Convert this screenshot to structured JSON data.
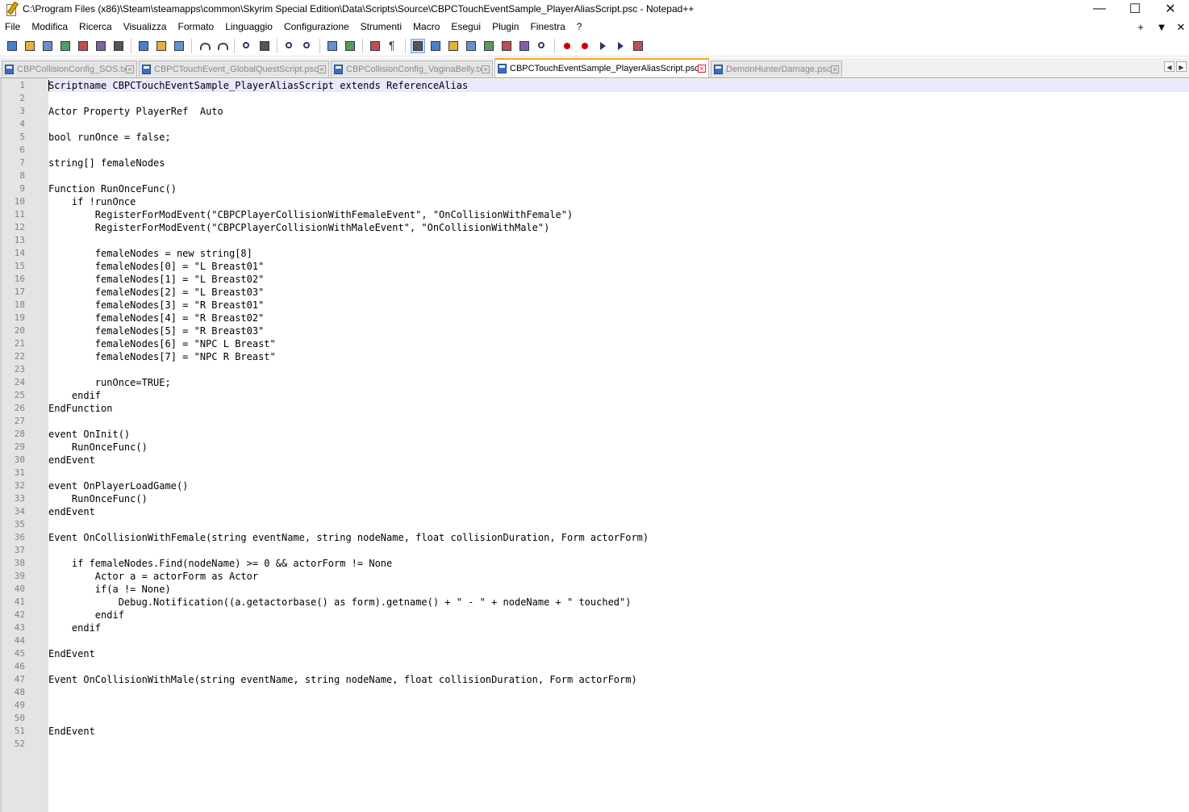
{
  "window": {
    "title": "C:\\Program Files (x86)\\Steam\\steamapps\\common\\Skyrim Special Edition\\Data\\Scripts\\Source\\CBPCTouchEventSample_PlayerAliasScript.psc - Notepad++",
    "minimize_glyph": "—",
    "maximize_glyph": "☐",
    "close_glyph": "✕"
  },
  "menu": {
    "items": [
      "File",
      "Modifica",
      "Ricerca",
      "Visualizza",
      "Formato",
      "Linguaggio",
      "Configurazione",
      "Strumenti",
      "Macro",
      "Esegui",
      "Plugin",
      "Finestra",
      "?"
    ],
    "right": [
      "+",
      "▼",
      "✕"
    ]
  },
  "toolbar": {
    "icons": [
      "new-file-icon",
      "open-file-icon",
      "save-icon",
      "save-all-icon",
      "close-icon",
      "close-all-icon",
      "print-icon",
      "|",
      "cut-icon",
      "copy-icon",
      "paste-icon",
      "|",
      "undo-icon",
      "redo-icon",
      "|",
      "find-icon",
      "replace-icon",
      "|",
      "zoom-in-icon",
      "zoom-out-icon",
      "|",
      "sync-vertical-icon",
      "sync-horizontal-icon",
      "|",
      "word-wrap-icon",
      "show-all-chars-icon",
      "|",
      "indent-guide-icon",
      "user-language-icon",
      "doc-map-icon",
      "function-list-icon",
      "folder-workspace-icon",
      "monitoring-icon",
      "doc-list-icon",
      "eye-icon",
      "|",
      "record-macro-icon",
      "stop-record-icon",
      "play-macro-icon",
      "run-macro-multiple-icon",
      "save-macro-icon"
    ],
    "active_icon": "indent-guide-icon"
  },
  "tabs": [
    {
      "label": "CBPCollisionConfig_SOS.txt",
      "active": false
    },
    {
      "label": "CBPCTouchEvent_GlobalQuestScript.psc",
      "active": false
    },
    {
      "label": "CBPCollisionConfig_VaginaBelly.txt",
      "active": false
    },
    {
      "label": "CBPCTouchEventSample_PlayerAliasScript.psc",
      "active": true
    },
    {
      "label": "DemonHunterDamage.psc",
      "active": false
    }
  ],
  "tab_scroll": {
    "left": "◀",
    "right": "▶"
  },
  "editor": {
    "current_line": 1,
    "lines": [
      "Scriptname CBPCTouchEventSample_PlayerAliasScript extends ReferenceAlias",
      "",
      "Actor Property PlayerRef  Auto",
      "",
      "bool runOnce = false;",
      "",
      "string[] femaleNodes",
      "",
      "Function RunOnceFunc()",
      "    if !runOnce",
      "        RegisterForModEvent(\"CBPCPlayerCollisionWithFemaleEvent\", \"OnCollisionWithFemale\")",
      "        RegisterForModEvent(\"CBPCPlayerCollisionWithMaleEvent\", \"OnCollisionWithMale\")",
      "",
      "        femaleNodes = new string[8]",
      "        femaleNodes[0] = \"L Breast01\"",
      "        femaleNodes[1] = \"L Breast02\"",
      "        femaleNodes[2] = \"L Breast03\"",
      "        femaleNodes[3] = \"R Breast01\"",
      "        femaleNodes[4] = \"R Breast02\"",
      "        femaleNodes[5] = \"R Breast03\"",
      "        femaleNodes[6] = \"NPC L Breast\"",
      "        femaleNodes[7] = \"NPC R Breast\"",
      "",
      "        runOnce=TRUE;",
      "    endif",
      "EndFunction",
      "",
      "event OnInit()",
      "    RunOnceFunc()",
      "endEvent",
      "",
      "event OnPlayerLoadGame()",
      "    RunOnceFunc()",
      "endEvent",
      "",
      "Event OnCollisionWithFemale(string eventName, string nodeName, float collisionDuration, Form actorForm)",
      "",
      "    if femaleNodes.Find(nodeName) >= 0 && actorForm != None",
      "        Actor a = actorForm as Actor",
      "        if(a != None)",
      "            Debug.Notification((a.getactorbase() as form).getname() + \" - \" + nodeName + \" touched\")",
      "        endif",
      "    endif",
      "",
      "EndEvent",
      "",
      "Event OnCollisionWithMale(string eventName, string nodeName, float collisionDuration, Form actorForm)",
      "",
      "",
      "",
      "EndEvent",
      ""
    ]
  }
}
